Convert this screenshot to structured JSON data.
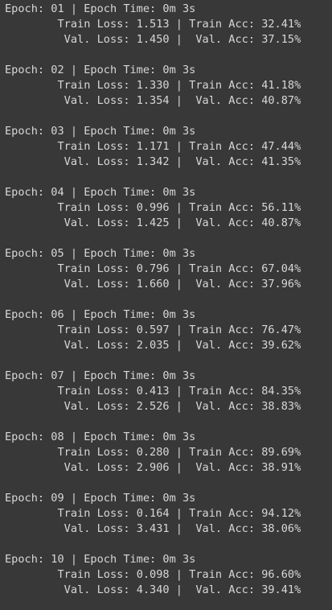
{
  "output": {
    "epochs": [
      {
        "header": "Epoch: 01 | Epoch Time: 0m 3s",
        "train": "\tTrain Loss: 1.513 | Train Acc: 32.41%",
        "val": "\t Val. Loss: 1.450 |  Val. Acc: 37.15%"
      },
      {
        "header": "Epoch: 02 | Epoch Time: 0m 3s",
        "train": "\tTrain Loss: 1.330 | Train Acc: 41.18%",
        "val": "\t Val. Loss: 1.354 |  Val. Acc: 40.87%"
      },
      {
        "header": "Epoch: 03 | Epoch Time: 0m 3s",
        "train": "\tTrain Loss: 1.171 | Train Acc: 47.44%",
        "val": "\t Val. Loss: 1.342 |  Val. Acc: 41.35%"
      },
      {
        "header": "Epoch: 04 | Epoch Time: 0m 3s",
        "train": "\tTrain Loss: 0.996 | Train Acc: 56.11%",
        "val": "\t Val. Loss: 1.425 |  Val. Acc: 40.87%"
      },
      {
        "header": "Epoch: 05 | Epoch Time: 0m 3s",
        "train": "\tTrain Loss: 0.796 | Train Acc: 67.04%",
        "val": "\t Val. Loss: 1.660 |  Val. Acc: 37.96%"
      },
      {
        "header": "Epoch: 06 | Epoch Time: 0m 3s",
        "train": "\tTrain Loss: 0.597 | Train Acc: 76.47%",
        "val": "\t Val. Loss: 2.035 |  Val. Acc: 39.62%"
      },
      {
        "header": "Epoch: 07 | Epoch Time: 0m 3s",
        "train": "\tTrain Loss: 0.413 | Train Acc: 84.35%",
        "val": "\t Val. Loss: 2.526 |  Val. Acc: 38.83%"
      },
      {
        "header": "Epoch: 08 | Epoch Time: 0m 3s",
        "train": "\tTrain Loss: 0.280 | Train Acc: 89.69%",
        "val": "\t Val. Loss: 2.906 |  Val. Acc: 38.91%"
      },
      {
        "header": "Epoch: 09 | Epoch Time: 0m 3s",
        "train": "\tTrain Loss: 0.164 | Train Acc: 94.12%",
        "val": "\t Val. Loss: 3.431 |  Val. Acc: 38.06%"
      },
      {
        "header": "Epoch: 10 | Epoch Time: 0m 3s",
        "train": "\tTrain Loss: 0.098 | Train Acc: 96.60%",
        "val": "\t Val. Loss: 4.340 |  Val. Acc: 39.41%"
      }
    ]
  }
}
